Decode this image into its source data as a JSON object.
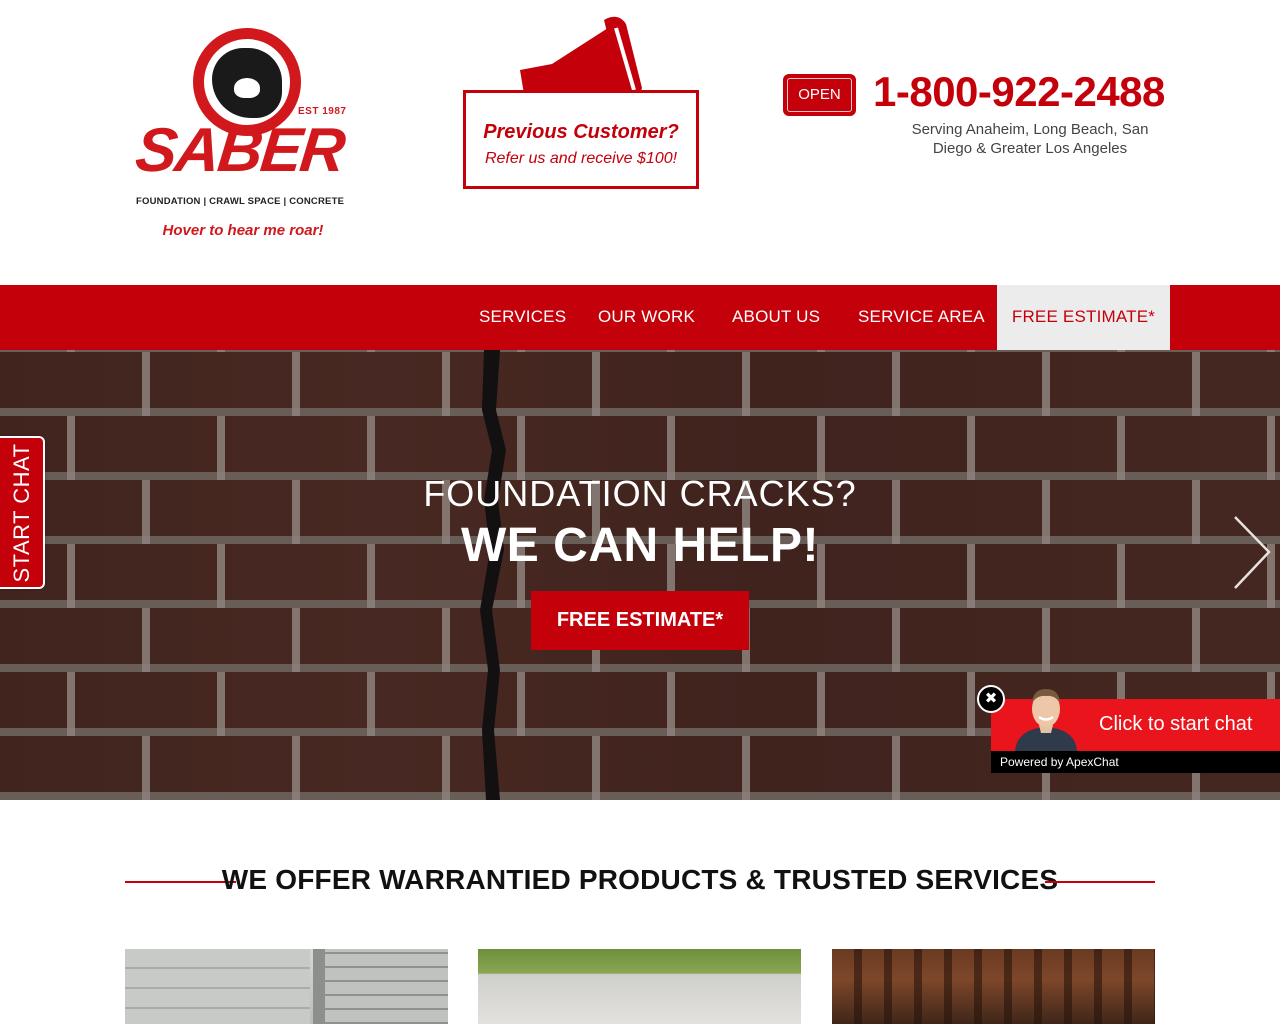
{
  "header": {
    "logo": {
      "est": "EST 1987",
      "wordmark": "SABER",
      "tagline": "FOUNDATION | CRAWL SPACE | CONCRETE"
    },
    "roar_text": "Hover to hear me roar!",
    "promo": {
      "title": "Previous Customer?",
      "subtitle": "Refer us and receive $100!",
      "icon": "megaphone-icon"
    },
    "open_badge": "OPEN",
    "phone": "1-800-922-2488",
    "serving": "Serving Anaheim, Long Beach, San Diego & Greater Los Angeles"
  },
  "nav": {
    "items": [
      {
        "label": "SERVICES"
      },
      {
        "label": "OUR WORK"
      },
      {
        "label": "ABOUT US"
      },
      {
        "label": "SERVICE AREA"
      },
      {
        "label": "FREE ESTIMATE*"
      }
    ]
  },
  "hero": {
    "line1": "FOUNDATION CRACKS?",
    "line2": "WE CAN HELP!",
    "button": "FREE ESTIMATE*",
    "next_icon": "chevron-right-icon"
  },
  "side_chat": {
    "label": "START CHAT"
  },
  "chat_widget": {
    "text": "Click to start chat",
    "powered_by": "Powered by ApexChat",
    "close_icon": "close-icon"
  },
  "services": {
    "title": "WE OFFER WARRANTIED PRODUCTS & TRUSTED SERVICES"
  },
  "colors": {
    "brand_red": "#c4000b",
    "chat_red": "#e9141c",
    "nav_active_bg": "#ececec"
  }
}
